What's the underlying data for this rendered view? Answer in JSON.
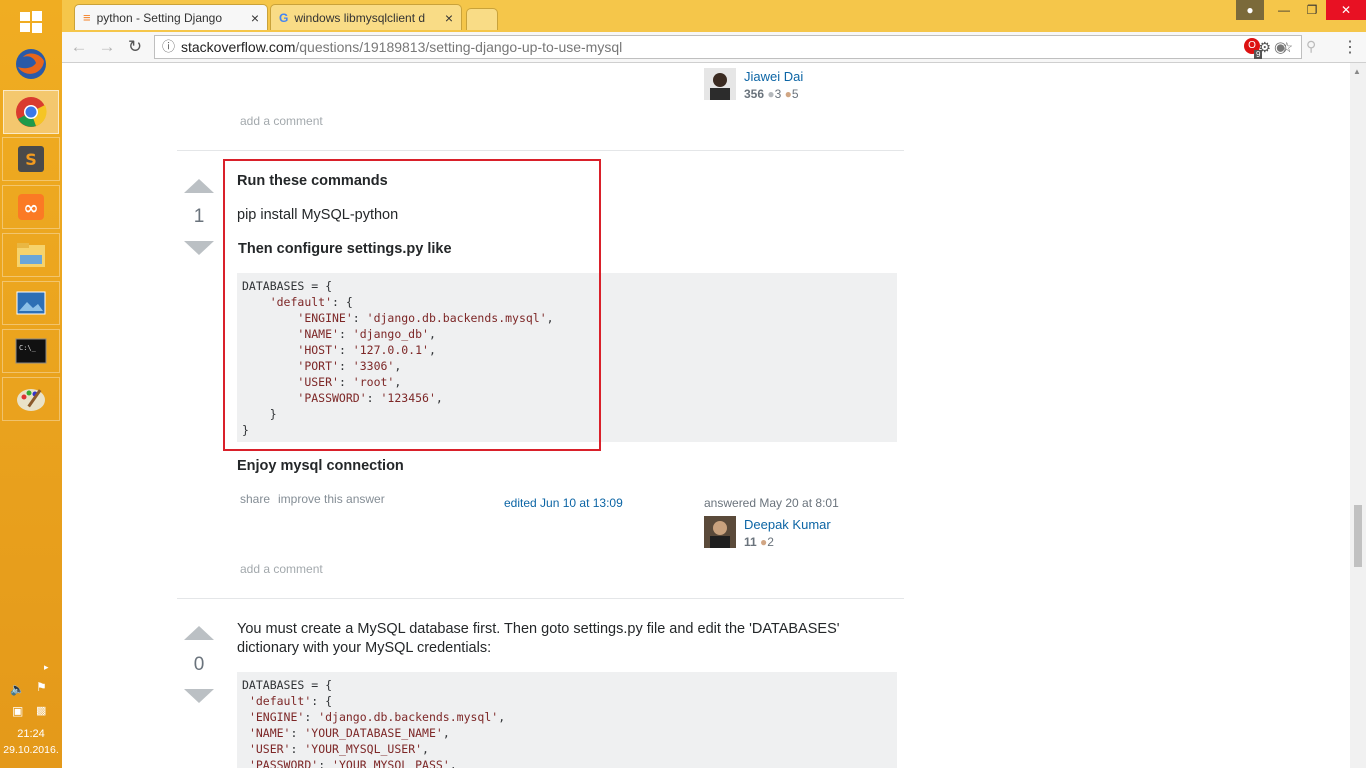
{
  "taskbar": {
    "icons": [
      "windows-start-icon",
      "firefox-icon",
      "chrome-icon",
      "sublime-text-icon",
      "xampp-icon",
      "file-explorer-icon",
      "photo-viewer-icon",
      "command-prompt-icon",
      "paint-icon"
    ],
    "tray": {
      "time": "21:24",
      "date": "29.10.2016."
    }
  },
  "browser": {
    "tabs": [
      {
        "title": "python - Setting Django",
        "close": "×"
      },
      {
        "title": "windows libmysqlclient d",
        "close": "×"
      }
    ],
    "url_host": "stackoverflow.com",
    "url_path": "/questions/19189813/setting-django-up-to-use-mysql",
    "extension_badge": "9"
  },
  "prev_answer": {
    "user_name": "Jiawei Dai",
    "reputation": "356",
    "silver": "3",
    "bronze": "5",
    "add_comment": "add a comment"
  },
  "answer": {
    "votes": "1",
    "heading1": "Run these commands",
    "command": "pip install MySQL-python",
    "heading2": "Then configure settings.py like",
    "code_lines": [
      "DATABASES = {",
      "    'default': {",
      "        'ENGINE': 'django.db.backends.mysql',",
      "        'NAME': 'django_db',",
      "        'HOST': '127.0.0.1',",
      "        'PORT': '3306',",
      "        'USER': 'root',",
      "        'PASSWORD': '123456',",
      "    }",
      "}"
    ],
    "closing": "Enjoy mysql connection",
    "share": "share",
    "improve": "improve this answer",
    "edited": "edited Jun 10 at 13:09",
    "answered": "answered May 20 at 8:01",
    "user_name": "Deepak Kumar",
    "reputation": "11",
    "bronze": "2",
    "add_comment": "add a comment"
  },
  "answer2": {
    "votes": "0",
    "text": "You must create a MySQL database first. Then goto settings.py file and edit the 'DATABASES' dictionary with your MySQL credentials:",
    "code_lines": [
      "DATABASES = {",
      " 'default': {",
      " 'ENGINE': 'django.db.backends.mysql',",
      " 'NAME': 'YOUR_DATABASE_NAME',",
      " 'USER': 'YOUR_MYSQL_USER',",
      " 'PASSWORD': 'YOUR_MYSQL_PASS',"
    ]
  },
  "colors": {
    "highlight_box": "#d9202a",
    "taskbar": "#e9a41a",
    "link": "#0c65a5"
  }
}
